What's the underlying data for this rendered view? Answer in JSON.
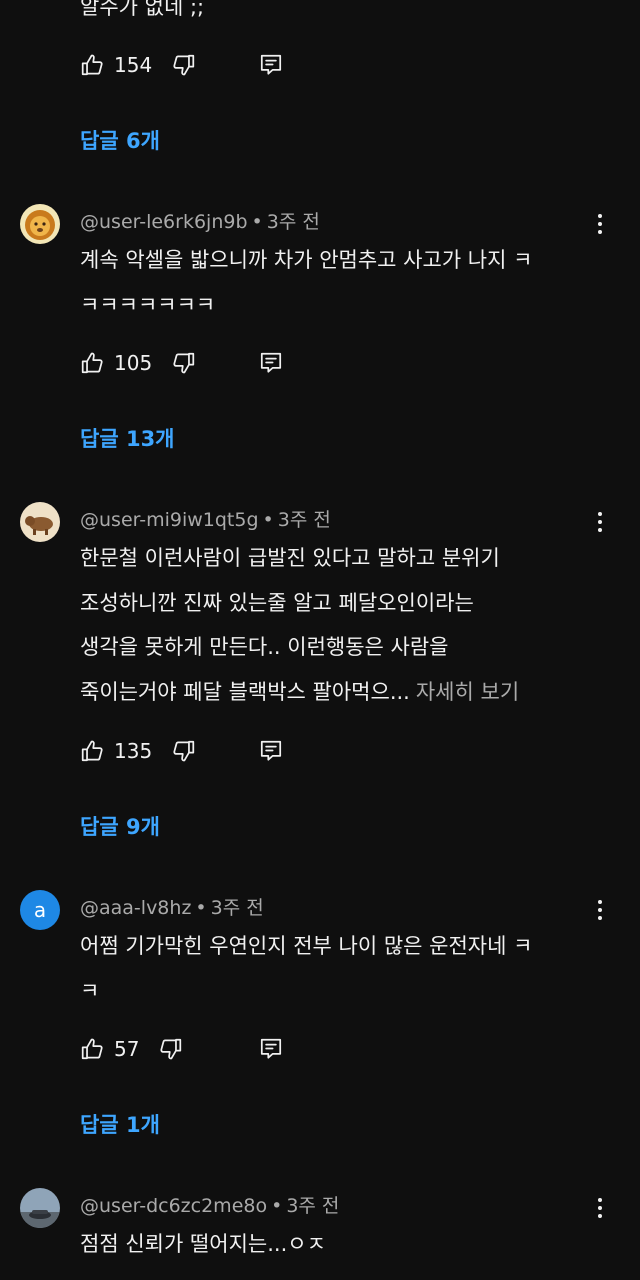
{
  "top_comment": {
    "text_partial": "알수가 없네 ;;",
    "likes": "154",
    "replies_label": "답글 6개"
  },
  "comments": [
    {
      "handle": "@user-le6rk6jn9b",
      "time": "3주 전",
      "avatar": "lion-avatar",
      "lines": [
        "계속 악셀을 밟으니까 차가 안멈추고 사고가 나지 ㅋ",
        "ㅋㅋㅋㅋㅋㅋㅋ"
      ],
      "likes": "105",
      "replies_label": "답글 13개"
    },
    {
      "handle": "@user-mi9iw1qt5g",
      "time": "3주 전",
      "avatar": "boar-avatar",
      "lines": [
        "한문철 이런사람이 급발진 있다고 말하고 분위기",
        "조성하니깐 진짜 있는줄 알고 페달오인이라는",
        "생각을 못하게 만든다.. 이런행동은 사람을",
        "죽이는거야 페달 블랙박스 팔아먹으..."
      ],
      "more_label": "자세히 보기",
      "likes": "135",
      "replies_label": "답글 9개"
    },
    {
      "handle": "@aaa-lv8hz",
      "time": "3주 전",
      "avatar": "letter-a-avatar",
      "avatar_letter": "a",
      "lines": [
        "어쩜 기가막힌 우연인지 전부 나이 많은 운전자네 ㅋ",
        "ㅋ"
      ],
      "likes": "57",
      "replies_label": "답글 1개"
    },
    {
      "handle": "@user-dc6zc2me8o",
      "time": "3주 전",
      "avatar": "car-photo-avatar",
      "lines": [
        "점점 신뢰가 떨어지는...ㅇㅈ"
      ]
    }
  ],
  "colors": {
    "background": "#0f0f0f",
    "text": "#f1f1f1",
    "meta": "#aaaaaa",
    "reply_link": "#3ea6ff",
    "letter_avatar": "#1e88e5"
  }
}
